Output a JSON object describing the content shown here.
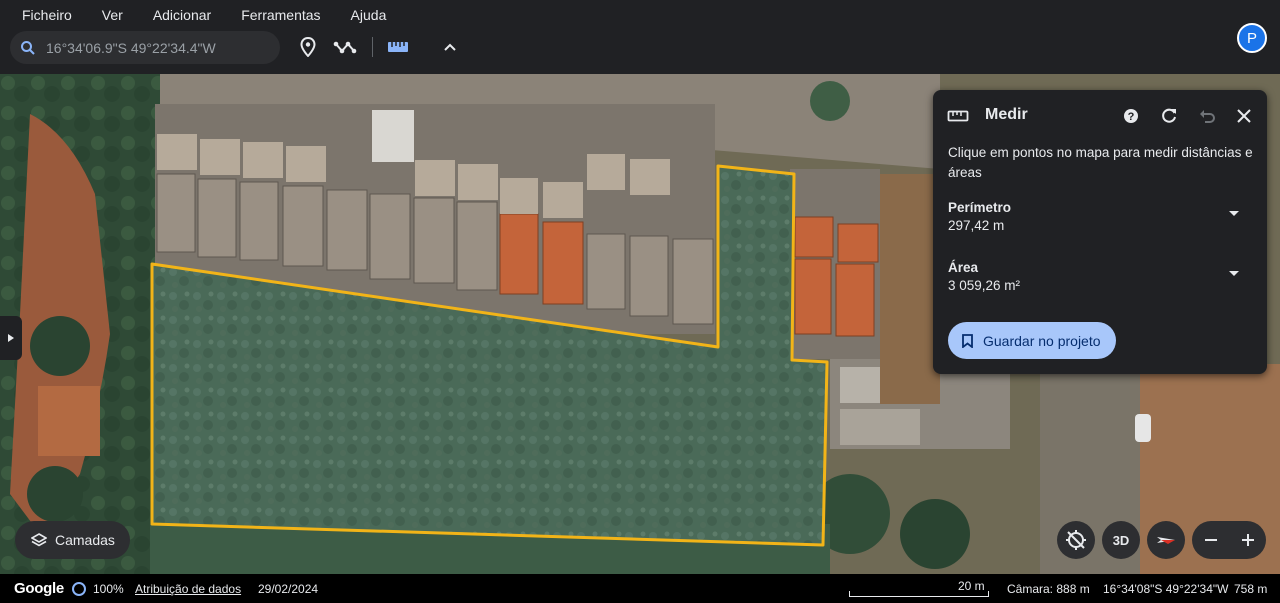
{
  "menu": [
    "Ficheiro",
    "Ver",
    "Adicionar",
    "Ferramentas",
    "Ajuda"
  ],
  "search": {
    "value": "16°34'06.9\"S 49°22'34.4\"W"
  },
  "toolbar": {
    "icons": [
      "search-icon",
      "location-pin-icon",
      "path-icon",
      "ruler-icon",
      "chevron-up-icon"
    ]
  },
  "user": {
    "avatar_letter": "P"
  },
  "measure_panel": {
    "title": "Medir",
    "description": "Clique em pontos no mapa para medir distâncias e áreas",
    "perimeter": {
      "label": "Perímetro",
      "value": "297,42 m"
    },
    "area": {
      "label": "Área",
      "value": "3 059,26 m²"
    },
    "save_label": "Guardar no projeto"
  },
  "controls": {
    "layers_label": "Camadas",
    "view_3d_label": "3D"
  },
  "status": {
    "logo": "Google",
    "loading_percent": "100%",
    "attribution": "Atribuição de dados",
    "date": "29/02/2024",
    "scale": "20 m",
    "camera": "Câmara: 888 m",
    "coordinates": "16°34'08\"S 49°22'34\"W",
    "elevation": "758 m"
  },
  "colors": {
    "measure_outline": "#f2b418",
    "accent": "#a8c7fa",
    "panel_bg": "#202124"
  }
}
